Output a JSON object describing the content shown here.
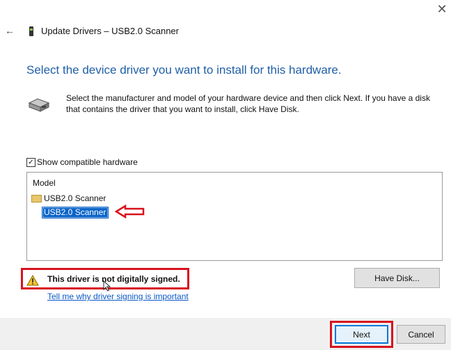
{
  "window": {
    "title": "Update Drivers – USB2.0 Scanner",
    "close_glyph": "✕",
    "back_glyph": "←"
  },
  "heading": "Select the device driver you want to install for this hardware.",
  "description": "Select the manufacturer and model of your hardware device and then click Next. If you have a disk that contains the driver that you want to install, click Have Disk.",
  "compatible": {
    "checked": true,
    "check_glyph": "✓",
    "label": "Show compatible hardware"
  },
  "list": {
    "header": "Model",
    "manufacturer": "USB2.0 Scanner",
    "selected_model": "USB2.0 Scanner"
  },
  "warning": {
    "text": "This driver is not digitally signed.",
    "link": "Tell me why driver signing is important"
  },
  "buttons": {
    "have_disk": "Have Disk...",
    "next": "Next",
    "cancel": "Cancel"
  },
  "colors": {
    "heading": "#1f5fa6",
    "selection": "#0a64c8",
    "highlight_red": "#d7121e",
    "link": "#0a58c7"
  },
  "icons": [
    "back-arrow-icon",
    "device-icon",
    "hardware-icon",
    "folder-icon",
    "warning-icon",
    "mouse-cursor-icon",
    "red-arrow-icon",
    "close-icon"
  ]
}
